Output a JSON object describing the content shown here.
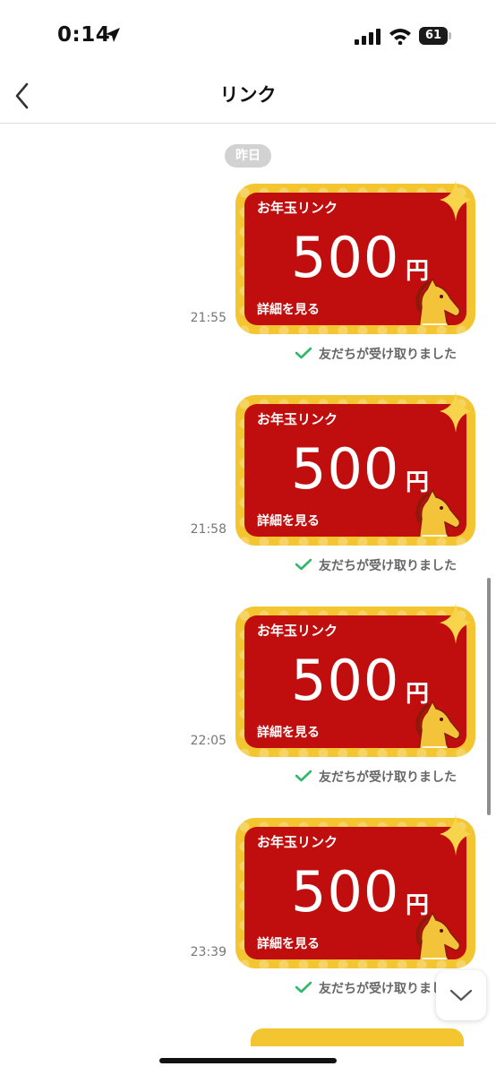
{
  "status_bar": {
    "time": "0:14",
    "battery": "61"
  },
  "header": {
    "title": "リンク"
  },
  "date_separator": "昨日",
  "messages": [
    {
      "card_title": "お年玉リンク",
      "amount": "500",
      "unit": "円",
      "detail_link": "詳細を見る",
      "time": "21:55",
      "read_status": "友だちが受け取りました"
    },
    {
      "card_title": "お年玉リンク",
      "amount": "500",
      "unit": "円",
      "detail_link": "詳細を見る",
      "time": "21:58",
      "read_status": "友だちが受け取りました"
    },
    {
      "card_title": "お年玉リンク",
      "amount": "500",
      "unit": "円",
      "detail_link": "詳細を見る",
      "time": "22:05",
      "read_status": "友だちが受け取りました"
    },
    {
      "card_title": "お年玉リンク",
      "amount": "500",
      "unit": "円",
      "detail_link": "詳細を見る",
      "time": "23:39",
      "read_status": "友だちが受け取りまし"
    }
  ],
  "colors": {
    "card_red": "#c00e0e",
    "card_gold": "#f2c531",
    "check_green": "#2fb86a"
  },
  "icons": [
    "location-arrow-icon",
    "signal-icon",
    "wifi-icon",
    "back-chevron-icon",
    "sparkle-icon",
    "horse-icon",
    "check-icon",
    "chevron-down-icon"
  ]
}
